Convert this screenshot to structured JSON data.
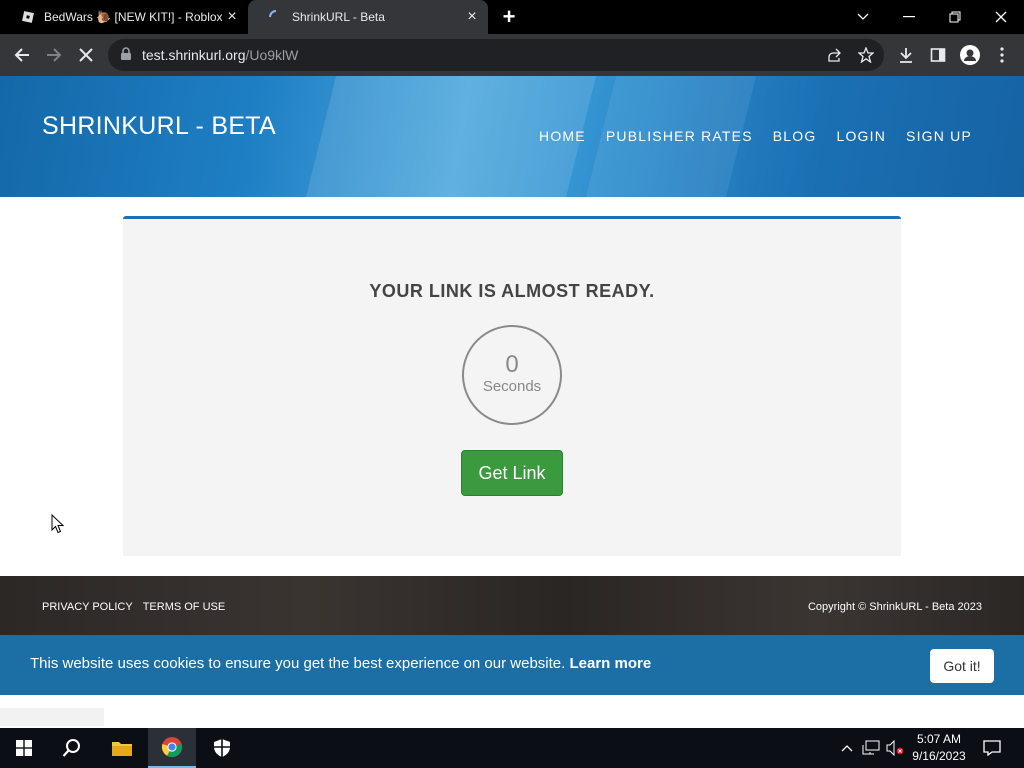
{
  "browser": {
    "tabs": [
      {
        "title": "BedWars 🐌 [NEW KIT!] - Roblox",
        "active": false
      },
      {
        "title": "ShrinkURL - Beta",
        "active": true
      }
    ],
    "url_domain": "test.shrinkurl.org",
    "url_path": "/Uo9klW"
  },
  "site": {
    "brand": "SHRINKURL - BETA",
    "nav": [
      "HOME",
      "PUBLISHER RATES",
      "BLOG",
      "LOGIN",
      "SIGN UP"
    ]
  },
  "card": {
    "title": "YOUR LINK IS ALMOST READY.",
    "timer_value": "0",
    "timer_unit": "Seconds",
    "button": "Get Link"
  },
  "footer": {
    "links": [
      "PRIVACY POLICY",
      "TERMS OF USE"
    ],
    "copyright": "Copyright © ShrinkURL - Beta 2023"
  },
  "cookie": {
    "message": "This website uses cookies to ensure you get the best experience on our website.",
    "learn_more": "Learn more",
    "button": "Got it!"
  },
  "taskbar": {
    "time": "5:07 AM",
    "date": "9/16/2023"
  },
  "colors": {
    "accent": "#1f6fb5",
    "button_green": "#3c9a3e",
    "cookie_bar": "#1c6fa5"
  }
}
